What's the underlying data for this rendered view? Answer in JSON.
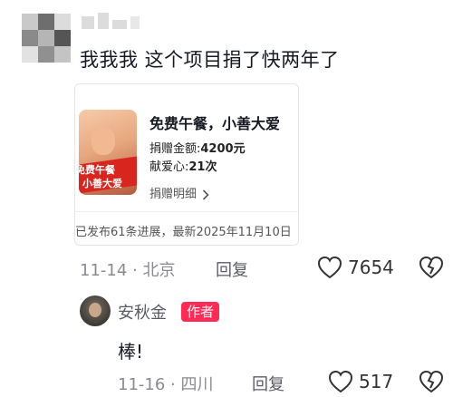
{
  "comment1": {
    "text": "我我我 这个项目捐了快两年了",
    "card": {
      "image_text_line1": "免费午餐",
      "image_text_line2": "小善大爱",
      "title": "免费午餐，小善大爱",
      "donation_label": "捐赠金额:",
      "donation_value": "4200元",
      "love_label": "献爱心:",
      "love_value": "21次",
      "details_link": "捐赠明细",
      "footer": "已发布61条进展，最新2025年11月10日"
    },
    "date": "11-14",
    "location": "北京",
    "separator": "·",
    "reply_label": "回复",
    "like_count": "7654"
  },
  "comment2": {
    "author_name": "安秋金",
    "author_badge": "作者",
    "text": "棒!",
    "date": "11-16",
    "location": "四川",
    "separator": "·",
    "reply_label": "回复",
    "like_count": "517"
  },
  "colors": {
    "accent": "#fe2c55",
    "meta_text": "#8a8b91",
    "primary_text": "#161823"
  },
  "icons": [
    "heart-icon",
    "dislike-icon",
    "chevron-right-icon"
  ]
}
